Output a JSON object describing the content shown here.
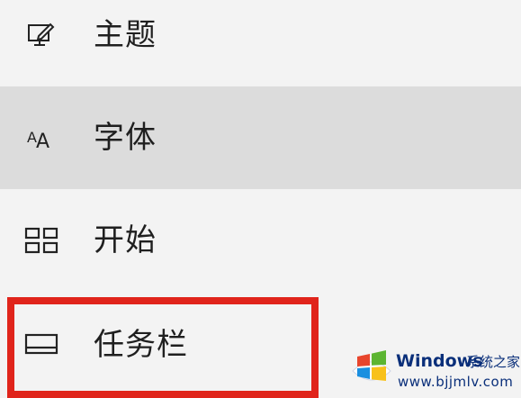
{
  "nav": {
    "items": [
      {
        "label": "主题",
        "icon": "theme-pen-monitor-icon"
      },
      {
        "label": "字体",
        "icon": "font-aa-icon",
        "selected": true
      },
      {
        "label": "开始",
        "icon": "start-grid-icon"
      },
      {
        "label": "任务栏",
        "icon": "taskbar-icon",
        "highlighted": true
      }
    ]
  },
  "colors": {
    "background": "#f3f3f3",
    "selected_background": "#dcdcdc",
    "highlight_border": "#e0241b",
    "watermark_text": "#0a2f7a"
  },
  "watermark": {
    "brand": "Windows",
    "brand_cn": "系统之家",
    "url": "www.bjjmlv.com"
  }
}
